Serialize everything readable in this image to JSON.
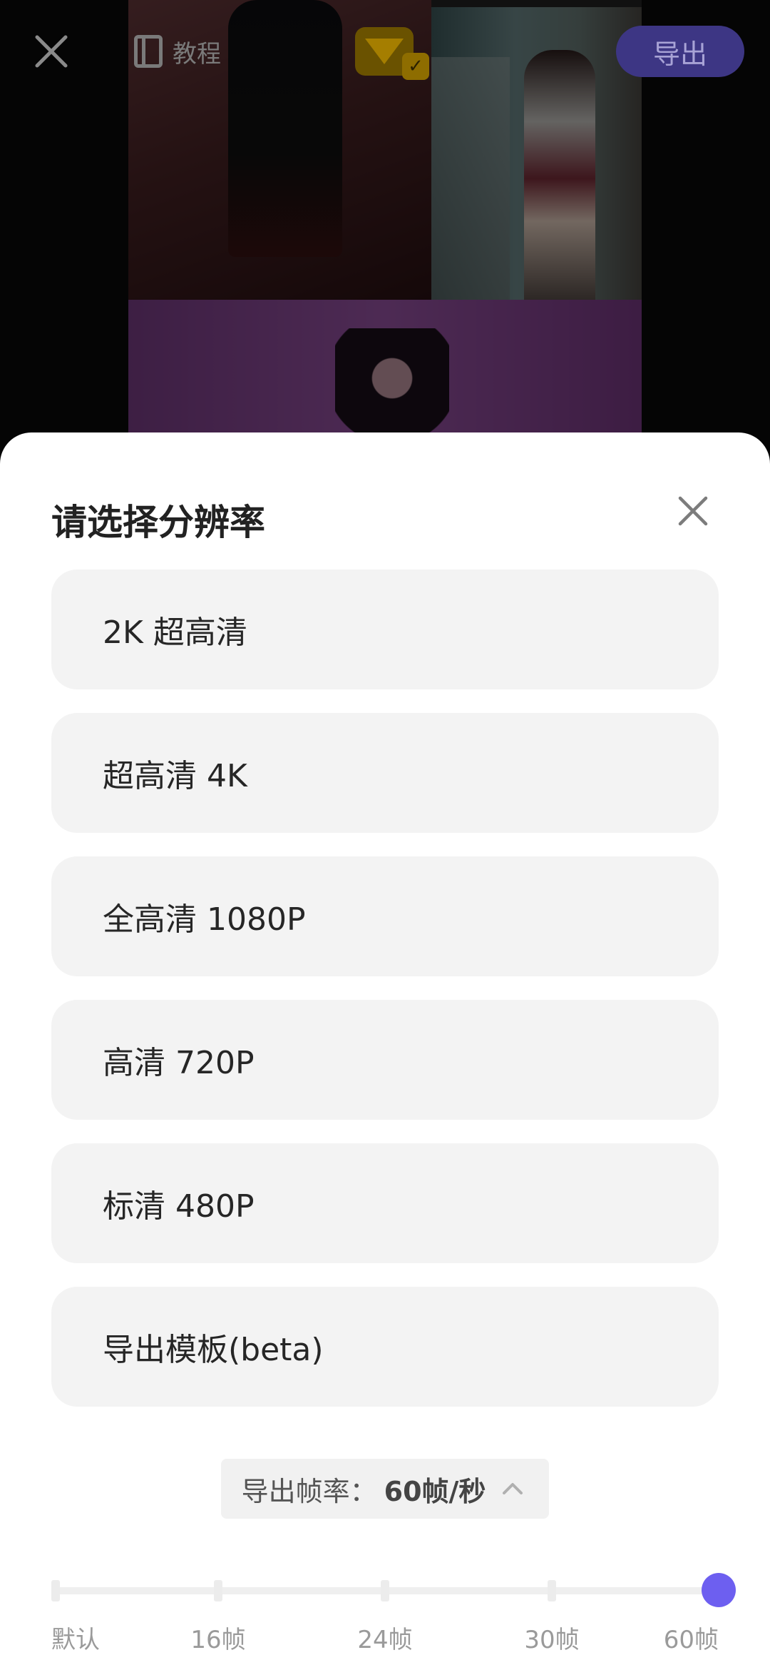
{
  "topbar": {
    "close_icon": "close-icon",
    "tutorial_label": "教程",
    "tutorial_icon": "book-icon",
    "vip_icon": "diamond-icon",
    "export_label": "导出"
  },
  "sheet": {
    "title": "请选择分辨率",
    "close_icon": "close-icon",
    "options": [
      {
        "label": "2K 超高清"
      },
      {
        "label": "超高清 4K"
      },
      {
        "label": "全高清 1080P"
      },
      {
        "label": "高清 720P"
      },
      {
        "label": "标清 480P"
      },
      {
        "label": "导出模板(beta)"
      }
    ],
    "frame_rate": {
      "label": "导出帧率：",
      "value": "60帧/秒",
      "chevron_icon": "chevron-up-icon",
      "ticks": [
        "默认",
        "16帧",
        "24帧",
        "30帧",
        "60帧"
      ],
      "selected_index": 4
    }
  },
  "colors": {
    "accent": "#6d5ff0",
    "option_bg": "#f3f3f3",
    "export_button_bg": "#3d3684"
  }
}
